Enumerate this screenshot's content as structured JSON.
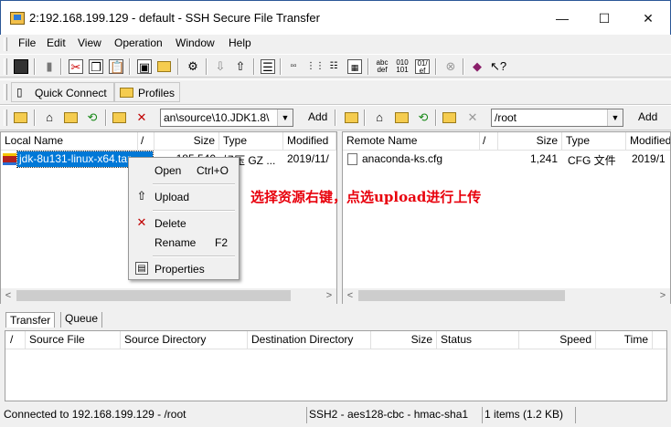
{
  "window": {
    "title": "2:192.168.199.129 - default - SSH Secure File Transfer",
    "min_glyph": "—",
    "max_glyph": "☐",
    "close_glyph": "✕"
  },
  "menu": [
    "File",
    "Edit",
    "View",
    "Operation",
    "Window",
    "Help"
  ],
  "quickbar": {
    "quick_connect": "Quick Connect",
    "profiles": "Profiles"
  },
  "local": {
    "path": "an\\source\\10.JDK1.8\\",
    "add_label": "Add",
    "columns": [
      "Local Name",
      "/",
      "Size",
      "Type",
      "Modified"
    ],
    "rows": [
      {
        "name": "jdk-8u131-linux-x64.tar",
        "size": "185,540",
        "type": "好压 GZ ...",
        "modified": "2019/11/"
      }
    ]
  },
  "remote": {
    "path": "/root",
    "add_label": "Add",
    "columns": [
      "Remote Name",
      "/",
      "Size",
      "Type",
      "Modified"
    ],
    "rows": [
      {
        "name": "anaconda-ks.cfg",
        "size": "1,241",
        "type": "CFG 文件",
        "modified": "2019/1"
      }
    ]
  },
  "context_menu": {
    "open": "Open",
    "open_key": "Ctrl+O",
    "upload": "Upload",
    "delete": "Delete",
    "rename": "Rename",
    "rename_key": "F2",
    "properties": "Properties"
  },
  "annotation": "选择资源右键，点选upload进行上传",
  "transfer_tabs": [
    "Transfer",
    "Queue"
  ],
  "transfer_columns": [
    "/",
    "Source File",
    "Source Directory",
    "Destination Directory",
    "Size",
    "Status",
    "Speed",
    "Time"
  ],
  "status": {
    "connection": "Connected to 192.168.199.129 - /root",
    "cipher": "SSH2 - aes128-cbc - hmac-sha1",
    "items": "1 items (1.2 KB)"
  },
  "colors": {
    "selection": "#0078d7",
    "annotation": "#e8000c",
    "delete_red": "#c00000"
  }
}
